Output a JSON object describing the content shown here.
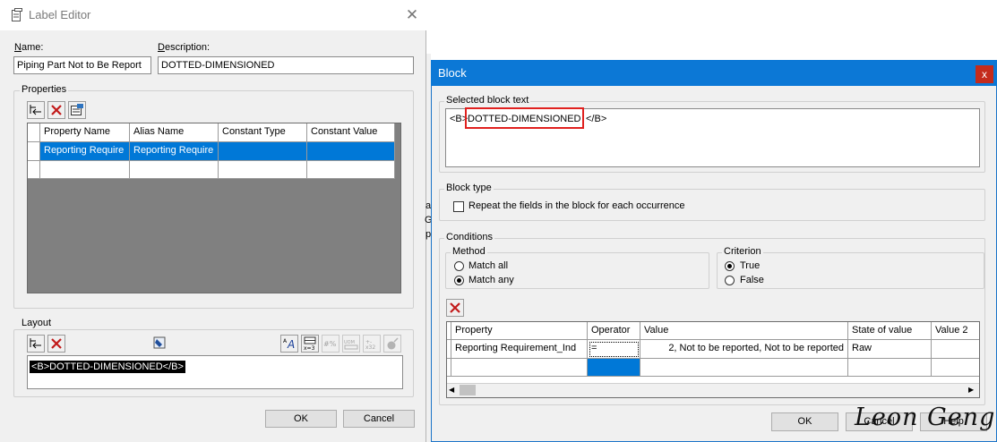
{
  "label_editor": {
    "title": "Label Editor",
    "name_label": "Name:",
    "name_value": "Piping Part Not to Be Report",
    "description_label": "Description:",
    "description_value": "DOTTED-DIMENSIONED",
    "properties_group": "Properties",
    "grid": {
      "columns": [
        "Property Name",
        "Alias Name",
        "Constant Type",
        "Constant Value"
      ],
      "rows": [
        {
          "property_name": "Reporting Require",
          "alias_name": "Reporting Require",
          "constant_type": "",
          "constant_value": ""
        }
      ]
    },
    "layout_group": "Layout",
    "layout_text": "<B>DOTTED-DIMENSIONED</B>",
    "ok_label": "OK",
    "cancel_label": "Cancel"
  },
  "block_dialog": {
    "title": "Block",
    "close_label": "x",
    "selected_block_group": "Selected block text",
    "selected_prefix": "<B>",
    "selected_highlight": "DOTTED-DIMENSIONED",
    "selected_suffix": "</B>",
    "block_type_group": "Block type",
    "repeat_checkbox_label": "Repeat the fields in the block for each occurrence",
    "conditions_group": "Conditions",
    "method_group": "Method",
    "match_all": "Match all",
    "match_any": "Match any",
    "criterion_group": "Criterion",
    "criterion_true": "True",
    "criterion_false": "False",
    "grid": {
      "columns": [
        "Property",
        "Operator",
        "Value",
        "State of value",
        "Value 2"
      ],
      "rows": [
        {
          "property": "Reporting Requirement_Ind",
          "operator": "=",
          "value": "2, Not to be reported, Not to be reported",
          "state": "Raw",
          "value2": ""
        }
      ]
    },
    "ok_label": "OK",
    "cancel_label": "Cancel",
    "help_label": "Help"
  },
  "background_fragments": [
    "a",
    "G",
    "p"
  ],
  "watermark": "Leon Geng",
  "colors": {
    "selection_blue": "#0078d7",
    "block_title_blue": "#0c78d6",
    "highlight_red": "#e0211f",
    "close_red": "#c42b1c"
  }
}
